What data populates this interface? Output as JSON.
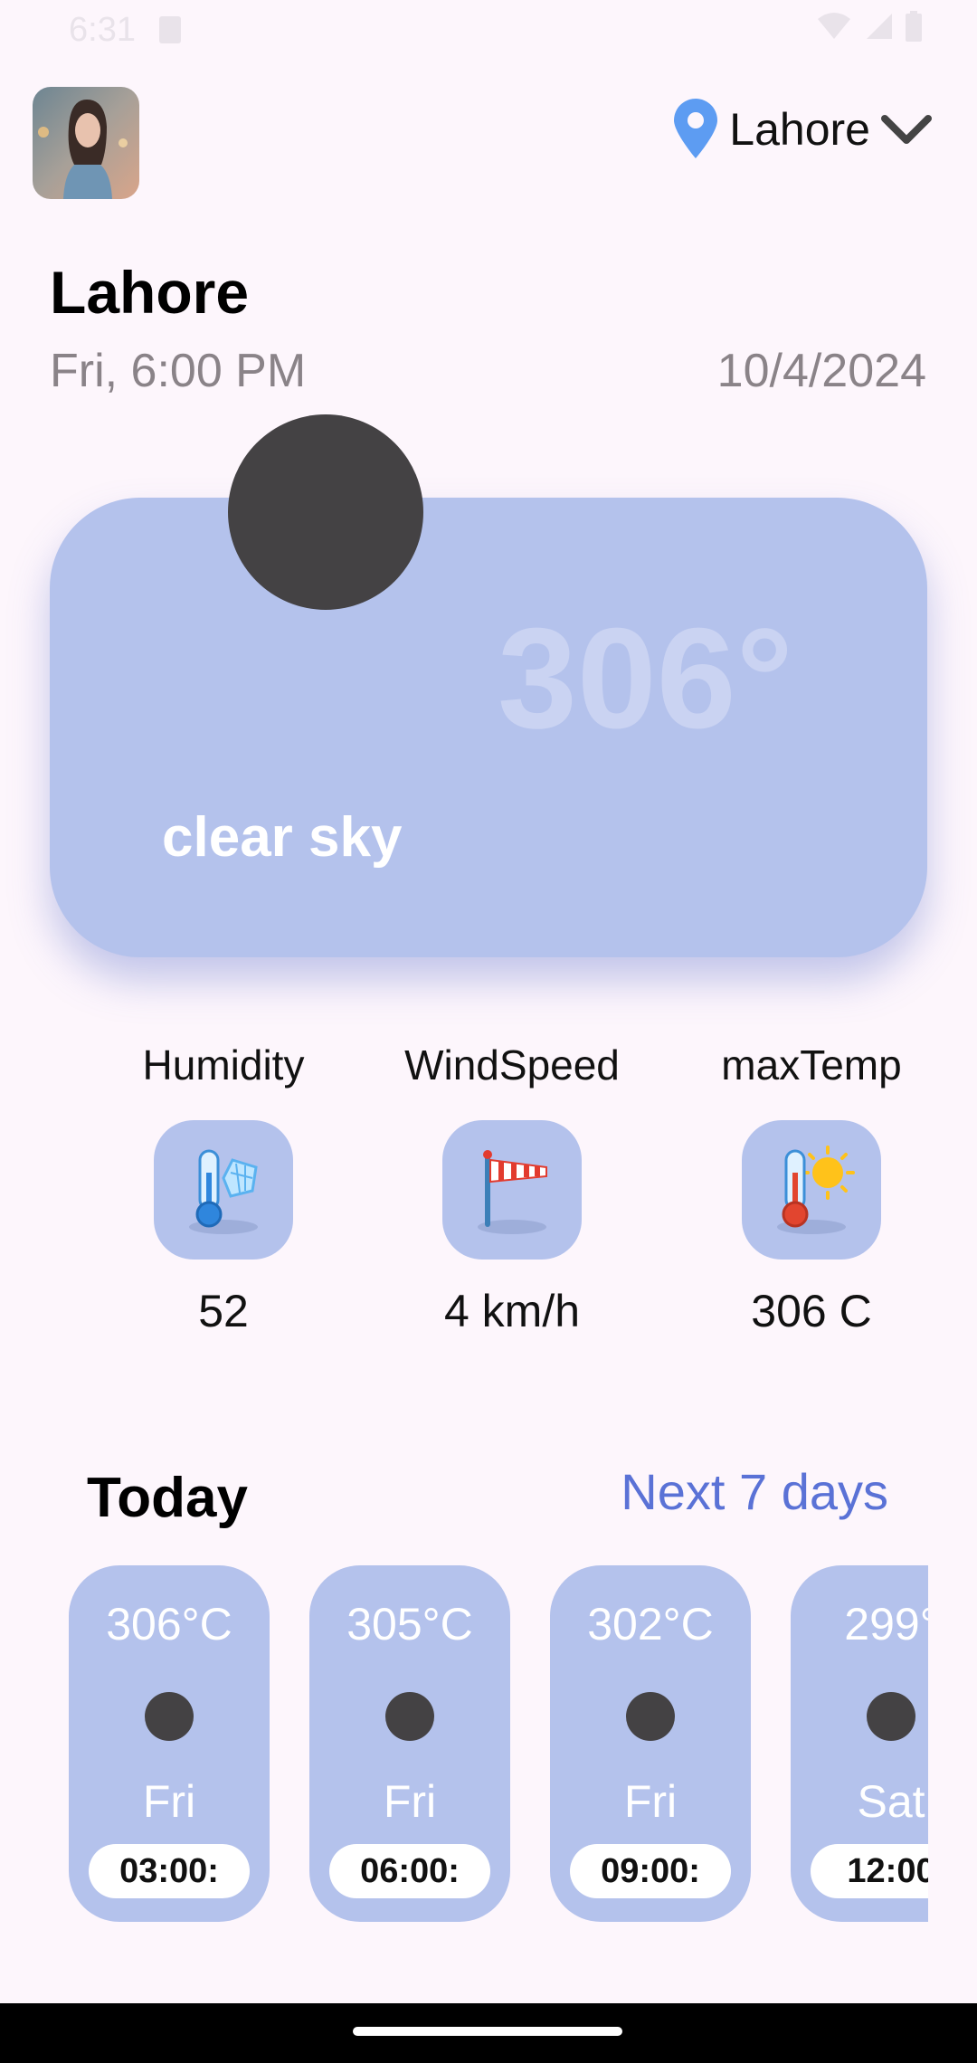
{
  "status_bar": {
    "time": "6:31",
    "icons": [
      "sd-card-icon",
      "wifi-icon",
      "signal-icon",
      "battery-icon"
    ]
  },
  "header": {
    "avatar": "profile-avatar",
    "location": "Lahore",
    "location_icon": "map-pin-icon",
    "dropdown_icon": "chevron-down-icon"
  },
  "summary": {
    "city": "Lahore",
    "day_time": "Fri, 6:00 PM",
    "date": "10/4/2024"
  },
  "current": {
    "temperature": "306°",
    "condition": "clear sky",
    "icon": "weather-icon"
  },
  "metrics": [
    {
      "label": "Humidity",
      "value": "52",
      "icon": "humidity-thermometer-icon"
    },
    {
      "label": "WindSpeed",
      "value": "4 km/h",
      "icon": "windsock-icon"
    },
    {
      "label": "maxTemp",
      "value": "306 C",
      "icon": "hot-thermometer-icon"
    }
  ],
  "today": {
    "title": "Today",
    "next_link": "Next 7 days",
    "forecast": [
      {
        "temp": "306°C",
        "day": "Fri",
        "time": "03:00:"
      },
      {
        "temp": "305°C",
        "day": "Fri",
        "time": "06:00:"
      },
      {
        "temp": "302°C",
        "day": "Fri",
        "time": "09:00:"
      },
      {
        "temp": "299°",
        "day": "Sat",
        "time": "12:00"
      }
    ]
  },
  "colors": {
    "background": "#fdf6fc",
    "card": "#b4c2ec",
    "accent_link": "#5a72d6",
    "muted_text": "#8a8388",
    "icon_placeholder": "#444244"
  }
}
